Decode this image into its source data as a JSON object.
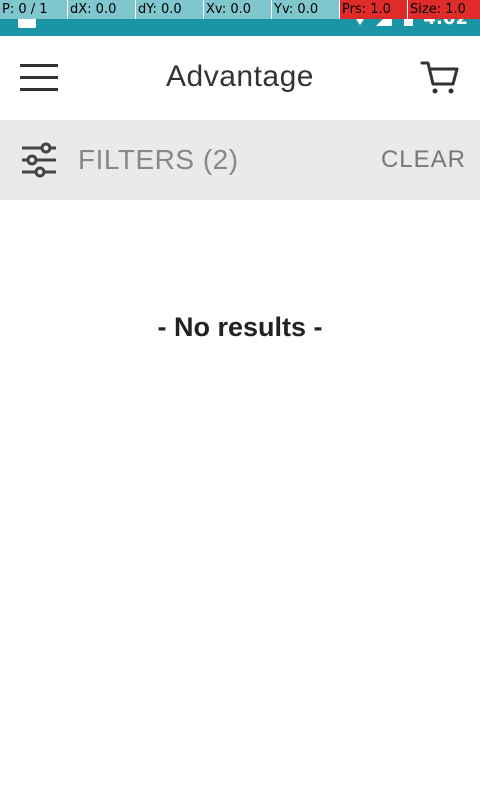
{
  "status_bar": {
    "time": "4:02",
    "icons": [
      "notification-icon",
      "wifi-icon",
      "signal-icon",
      "battery-icon"
    ]
  },
  "debug_overlay": {
    "pointer": "P: 0 / 1",
    "dx": "dX: 0.0",
    "dy": "dY: 0.0",
    "xv": "Xv: 0.0",
    "yv": "Yv: 0.0",
    "prs": "Prs: 1.0",
    "size": "Size: 1.0"
  },
  "app_bar": {
    "title": "Advantage",
    "menu_icon": "hamburger-menu-icon",
    "cart_icon": "shopping-cart-icon"
  },
  "filters": {
    "label": "FILTERS (2)",
    "clear_label": "CLEAR",
    "icon": "sliders-icon"
  },
  "results": {
    "empty_message": "- No results -"
  },
  "colors": {
    "status_bar": "#1b95a5",
    "filters_bg": "#eaeaea",
    "debug_bg": "#7fc6cf",
    "debug_alert": "#e02b2b"
  }
}
